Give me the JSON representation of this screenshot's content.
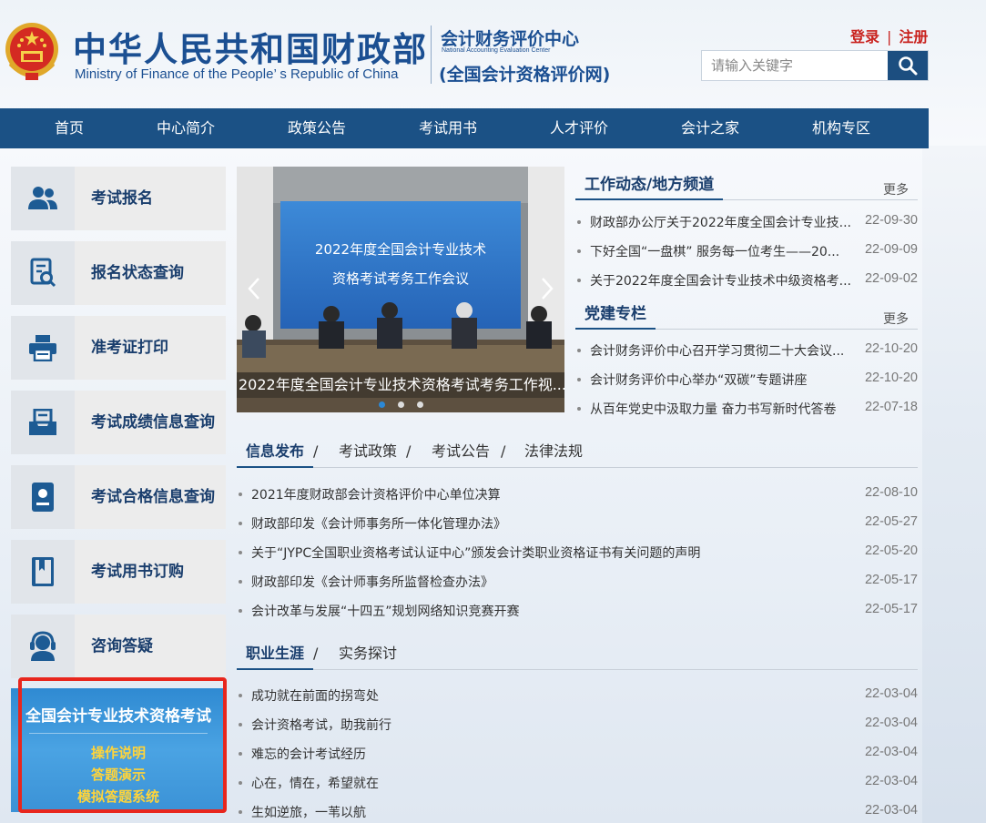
{
  "header": {
    "site_title_cn": "中华人民共和国财政部",
    "site_title_en": "Ministry of Finance of the People’ s Republic of China",
    "center_cn": "会计财务评价中心",
    "center_en": "National Accounting Evaluation Center",
    "center_sub": "(全国会计资格评价网)",
    "login": "登录",
    "register": "注册",
    "search_placeholder": "请输入关键字"
  },
  "nav": [
    "首页",
    "中心简介",
    "政策公告",
    "考试用书",
    "人才评价",
    "会计之家",
    "机构专区"
  ],
  "sidebar": [
    {
      "label": "考试报名",
      "icon": "users-icon"
    },
    {
      "label": "报名状态查询",
      "icon": "document-search-icon"
    },
    {
      "label": "准考证打印",
      "icon": "printer-icon"
    },
    {
      "label": "考试成绩信息查询",
      "icon": "tray-icon"
    },
    {
      "label": "考试合格信息查询",
      "icon": "certificate-icon"
    },
    {
      "label": "考试用书订购",
      "icon": "book-icon"
    },
    {
      "label": "咨询答疑",
      "icon": "headset-icon"
    }
  ],
  "promo": {
    "title": "全国会计专业技术资格考试",
    "links": [
      "操作说明",
      "答题演示",
      "模拟答题系统"
    ]
  },
  "carousel": {
    "screen_line1": "2022年度全国会计专业技术",
    "screen_line2": "资格考试考务工作会议",
    "caption": "2022年度全国会计专业技术资格考试考务工作视..."
  },
  "work_news": {
    "title": "工作动态/地方频道",
    "more": "更多",
    "items": [
      {
        "text": "财政部办公厅关于2022年度全国会计专业技...",
        "date": "22-09-30"
      },
      {
        "text": "下好全国“一盘棋” 服务每一位考生——20...",
        "date": "22-09-09"
      },
      {
        "text": "关于2022年度全国会计专业技术中级资格考...",
        "date": "22-09-02"
      }
    ]
  },
  "party_news": {
    "title": "党建专栏",
    "more": "更多",
    "items": [
      {
        "text": "会计财务评价中心召开学习贯彻二十大会议...",
        "date": "22-10-20"
      },
      {
        "text": "会计财务评价中心举办“双碳”专题讲座",
        "date": "22-10-20"
      },
      {
        "text": "从百年党史中汲取力量 奋力书写新时代答卷",
        "date": "22-07-18"
      }
    ]
  },
  "info_tabs": {
    "tabs": [
      "信息发布",
      "考试政策",
      "考试公告",
      "法律法规"
    ],
    "items": [
      {
        "text": "2021年度财政部会计资格评价中心单位决算",
        "date": "22-08-10"
      },
      {
        "text": "财政部印发《会计师事务所一体化管理办法》",
        "date": "22-05-27"
      },
      {
        "text": "关于“JYPC全国职业资格考试认证中心”颁发会计类职业资格证书有关问题的声明",
        "date": "22-05-20"
      },
      {
        "text": "财政部印发《会计师事务所监督检查办法》",
        "date": "22-05-17"
      },
      {
        "text": "会计改革与发展“十四五”规划网络知识竞赛开赛",
        "date": "22-05-17"
      }
    ]
  },
  "career_tabs": {
    "tabs": [
      "职业生涯",
      "实务探讨"
    ],
    "items": [
      {
        "text": "成功就在前面的拐弯处",
        "date": "22-03-04"
      },
      {
        "text": "会计资格考试，助我前行",
        "date": "22-03-04"
      },
      {
        "text": "难忘的会计考试经历",
        "date": "22-03-04"
      },
      {
        "text": "心在，情在，希望就在",
        "date": "22-03-04"
      },
      {
        "text": "生如逆旅，一苇以航",
        "date": "22-03-04"
      }
    ]
  },
  "colors": {
    "nav_bg": "#1b5185",
    "brand_blue": "#1b4f92",
    "auth_red": "#c9231f",
    "promo_yellow": "#ffd43a",
    "highlight_red": "#e8261d"
  }
}
